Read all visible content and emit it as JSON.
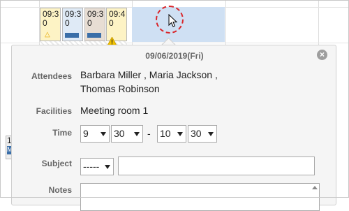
{
  "calendar": {
    "events": [
      {
        "time": "09:3\n0",
        "bg": "#fdf3c5",
        "marker": "warning-triangle"
      },
      {
        "time": "09:3\n0",
        "bg": "#dfeaf6",
        "marker": "blue-bar"
      },
      {
        "time": "09:3\n0",
        "bg": "#e7ddd3",
        "marker": "blue-bar"
      },
      {
        "time": "09:4\n0",
        "bg": "#fdf3c5",
        "marker": "warning-icon"
      }
    ],
    "left_event": {
      "time": "1",
      "label": "M"
    }
  },
  "popup": {
    "date": "09/06/2019(Fri)",
    "close_icon": "close-icon",
    "attendees_label": "Attendees",
    "attendees_line1": "Barbara Miller ,  Maria Jackson ,",
    "attendees_line2": "Thomas Robinson",
    "facilities_label": "Facilities",
    "facilities_value": "Meeting room 1",
    "time_label": "Time",
    "start_hour": "9",
    "start_minute": "30",
    "separator": "-",
    "end_hour": "10",
    "end_minute": "30",
    "subject_label": "Subject",
    "subject_select": "-----",
    "subject_input": "",
    "notes_label": "Notes"
  },
  "colors": {
    "highlight": "#cfe0f3",
    "cursor_ring": "#d9262a",
    "event_blue": "#3a6ea8"
  }
}
